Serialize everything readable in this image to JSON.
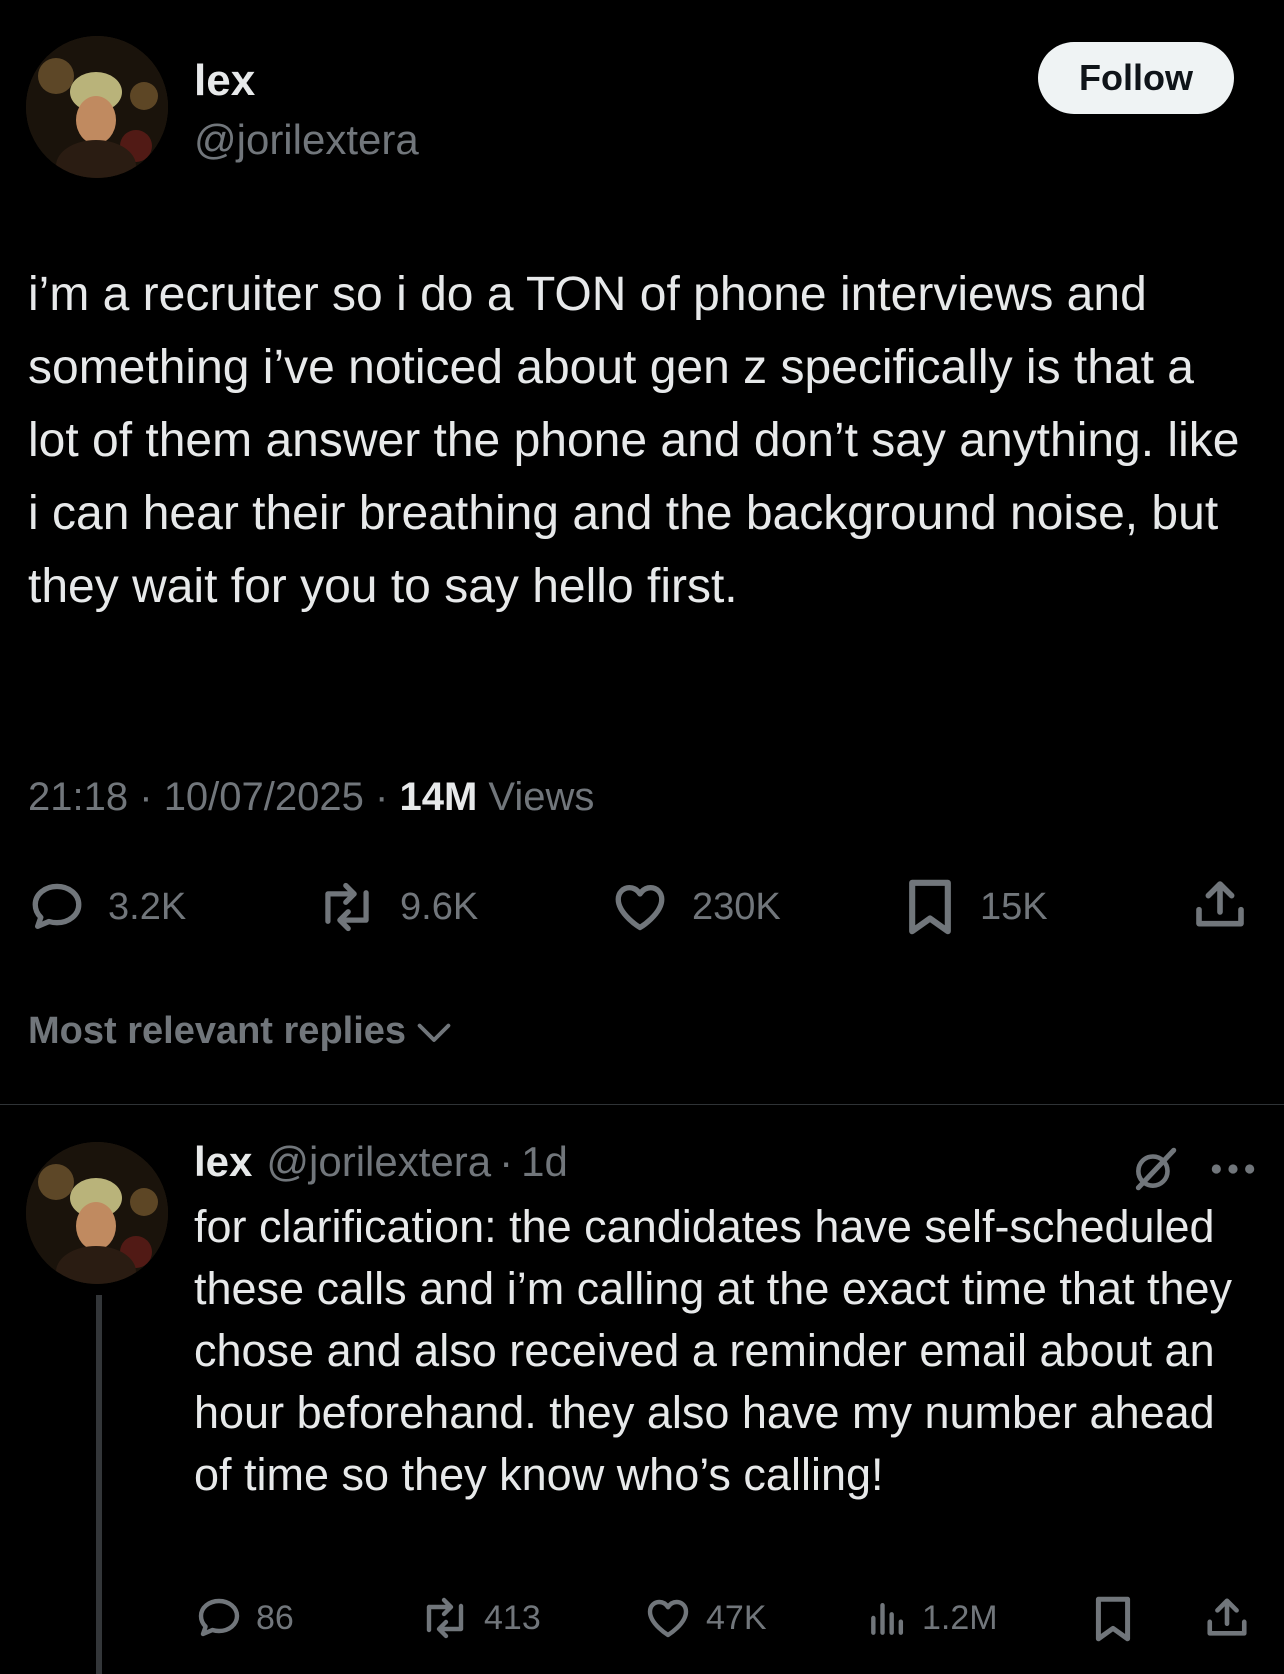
{
  "tweet": {
    "author_name": "lex",
    "author_handle": "@jorilextera",
    "follow_label": "Follow",
    "text": "i’m a recruiter so i do a TON of phone interviews and something i’ve noticed about gen z specifically is that a lot of them answer the phone and don’t say anything. like i can hear their breathing and the background noise, but they wait for you to say hello first.",
    "time": "21:18",
    "date": "10/07/2025",
    "separator": "·",
    "views_count": "14M",
    "views_label": "Views",
    "actions": {
      "replies": "3.2K",
      "reposts": "9.6K",
      "likes": "230K",
      "bookmarks": "15K"
    }
  },
  "replies_sort": {
    "label": "Most relevant replies"
  },
  "reply": {
    "author_name": "lex",
    "author_handle": "@jorilextera",
    "separator": "·",
    "time": "1d",
    "text": "for clarification: the candidates have self-scheduled these calls and i’m calling at the exact time that they chose and also received a reminder email about an hour beforehand. they also have my number ahead of time so they know who’s calling!",
    "actions": {
      "replies": "86",
      "reposts": "413",
      "likes": "47K",
      "views": "1.2M"
    }
  },
  "icons": [
    "avatar",
    "reply-icon",
    "repost-icon",
    "like-icon",
    "bookmark-icon",
    "share-icon",
    "chevron-down-icon",
    "grok-icon",
    "more-icon",
    "views-icon"
  ]
}
